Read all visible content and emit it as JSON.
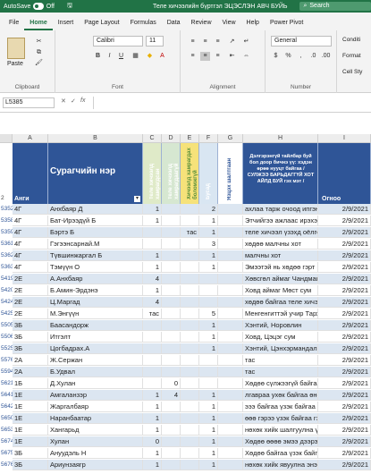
{
  "titlebar": {
    "autosave": "AutoSave",
    "autosave_state": "Off",
    "title": "Теле хичээлийн бүртгэл ЭЦЭСЛЭН АВЧ БУЙЬ",
    "search": "Search"
  },
  "tabs": [
    "File",
    "Home",
    "Insert",
    "Page Layout",
    "Formulas",
    "Data",
    "Review",
    "View",
    "Help",
    "Power Pivot"
  ],
  "ribbon": {
    "paste": "Paste",
    "clipboard": "Clipboard",
    "font_name": "Calibri",
    "font_size": "11",
    "font": "Font",
    "alignment": "Alignment",
    "number_format": "General",
    "number": "Number",
    "conditional": "Conditi",
    "format_as": "Format",
    "cell_styles": "Cell Sty",
    "bold": "B",
    "italic": "I",
    "underline": "U"
  },
  "formula_bar": {
    "name_box": "L5385",
    "fx": "fx",
    "value": ""
  },
  "columns": [
    "A",
    "B",
    "C",
    "D",
    "E",
    "F",
    "G",
    "H",
    "I"
  ],
  "headers": {
    "row_label": "2",
    "a": "Анги",
    "b": "Сурагчийн нэр",
    "h": "Дэлгэрэнгүй тайлбар буй бол доор бичнэ үү: хэдэн өрөө нууцт байгаа / СУЛЖЭЭ БАРЬДАГГҮЙ ХОТ АЙЛД БУЙ гэх мэт /",
    "i": "Огноо",
    "g": "Язцэх шалтгаан",
    "c": "Теле хичээлд хамрагдсан",
    "d": "Теле хичээлд хамрагдаагүй",
    "e": "Хичээлд хамрагдах боломжгүй",
    "f": "Бусад"
  },
  "rows": [
    {
      "num": "5352",
      "a": "4Г",
      "b": "Анхбаяр Д",
      "c": "1",
      "d": "",
      "e": "",
      "f": "2",
      "g": "",
      "h": "ахлаа тарж очоод ипгэн",
      "i": "2/9/2021"
    },
    {
      "num": "5358",
      "a": "4Г",
      "b": "Бат-Ирээдүй Б",
      "c": "1",
      "d": "",
      "e": "",
      "f": "1",
      "g": "",
      "h": "Этчийгээ ажлаас ирэхээр",
      "i": "2/9/2021"
    },
    {
      "num": "5359",
      "a": "4Г",
      "b": "Бэртэ Б",
      "c": "",
      "d": "",
      "e": "тас",
      "f": "1",
      "g": "",
      "h": "теле хичээл үзэхд оёлгох",
      "i": "2/9/2021"
    },
    {
      "num": "5361",
      "a": "4Г",
      "b": "Гэгээнсарнай.М",
      "c": "",
      "d": "",
      "e": "",
      "f": "3",
      "g": "",
      "h": "хөдөө малчны хот",
      "i": "2/9/2021"
    },
    {
      "num": "5362",
      "a": "4Г",
      "b": "Түвшинжаргал Б",
      "c": "1",
      "d": "",
      "e": "",
      "f": "1",
      "g": "",
      "h": "малчны хот",
      "i": "2/9/2021"
    },
    {
      "num": "5363",
      "a": "4Г",
      "b": "Тэмүүн О",
      "c": "1",
      "d": "",
      "e": "",
      "f": "1",
      "g": "",
      "h": "Эмээтэй нь хөдөө гэрт",
      "i": "2/9/2021"
    },
    {
      "num": "5419",
      "a": "2Е",
      "b": "А.Анхбаяр",
      "c": "4",
      "d": "",
      "e": "",
      "f": "",
      "g": "",
      "h": "Хөвсгөл аймаг Чандмань",
      "i": "2/9/2021"
    },
    {
      "num": "5420",
      "a": "2Е",
      "b": "Б.Амин-Эрдэнэ",
      "c": "1",
      "d": "",
      "e": "",
      "f": "",
      "g": "",
      "h": "Ховд аймаг Мөст сум",
      "i": "2/9/2021"
    },
    {
      "num": "5424",
      "a": "2Е",
      "b": "Ц.Маргад",
      "c": "4",
      "d": "",
      "e": "",
      "f": "",
      "g": "",
      "h": "хөдөө байгаа теле хичээл",
      "i": "2/9/2021"
    },
    {
      "num": "5425",
      "a": "2Е",
      "b": "М.Энгүүн",
      "c": "тас",
      "d": "",
      "e": "",
      "f": "5",
      "g": "",
      "h": "Менгенгиттэй учир Тархин",
      "i": "2/9/2021"
    },
    {
      "num": "5505",
      "a": "3Б",
      "b": "Баасандорж",
      "c": "",
      "d": "",
      "e": "",
      "f": "1",
      "g": "",
      "h": "Хэнтий, Норовлин",
      "i": "2/9/2021"
    },
    {
      "num": "5506",
      "a": "3Б",
      "b": "Итгэлт",
      "c": "",
      "d": "",
      "e": "",
      "f": "1",
      "g": "",
      "h": "Ховд, Цэцэг сум",
      "i": "2/9/2021"
    },
    {
      "num": "5525",
      "a": "3Б",
      "b": "Цогбадрах.А",
      "c": "",
      "d": "",
      "e": "",
      "f": "1",
      "g": "",
      "h": "Хэнтий, Цэнхэрмандал",
      "i": "2/9/2021"
    },
    {
      "num": "5576",
      "a": "2А",
      "b": "Ж.Сержан",
      "c": "",
      "d": "",
      "e": "",
      "f": "",
      "g": "",
      "h": "тас",
      "i": "2/9/2021"
    },
    {
      "num": "5594",
      "a": "2А",
      "b": "Б.Удвал",
      "c": "",
      "d": "",
      "e": "",
      "f": "",
      "g": "",
      "h": "тас",
      "i": "2/9/2021"
    },
    {
      "num": "5621",
      "a": "1Б",
      "b": "Д.Хулан",
      "c": "",
      "d": "0",
      "e": "",
      "f": "",
      "g": "",
      "h": "Хөдөө сүлжээгүй байгаа",
      "i": "2/9/2021"
    },
    {
      "num": "5641",
      "a": "1Е",
      "b": "Амгаланзэр",
      "c": "1",
      "d": "4",
      "e": "",
      "f": "1",
      "g": "",
      "h": "лгавраа ухөк байгаа өнөө маргаа",
      "i": "2/9/2021"
    },
    {
      "num": "5642",
      "a": "1Е",
      "b": "Жаргалбаяр",
      "c": "1",
      "d": "",
      "e": "",
      "f": "1",
      "g": "",
      "h": "эээ байгаа үзэк байгаа 5 дахь бүр",
      "i": "2/9/2021"
    },
    {
      "num": "5650",
      "a": "1Е",
      "b": "Наранбаатар",
      "c": "1",
      "d": "",
      "e": "",
      "f": "1",
      "g": "",
      "h": "өөө гэрээ үзэк байгаа гэмгэрээ",
      "i": "2/9/2021"
    },
    {
      "num": "5653",
      "a": "1Е",
      "b": "Хангарьд",
      "c": "1",
      "d": "",
      "e": "",
      "f": "1",
      "g": "",
      "h": "нөхөк хийк шалгуулна үзэхээ мэ",
      "i": "2/9/2021"
    },
    {
      "num": "5674",
      "a": "1Е",
      "b": "Хулан",
      "c": "0",
      "d": "",
      "e": "",
      "f": "1",
      "g": "",
      "h": "Хөдөө өөөө эмээ дээрээ байг",
      "i": "2/9/2021"
    },
    {
      "num": "5675",
      "a": "3Б",
      "b": "Ануудэль Н",
      "c": "1",
      "d": "",
      "e": "",
      "f": "1",
      "g": "",
      "h": "Хөдөө байгаа үзэк байгаа даалг",
      "i": "2/9/2021"
    },
    {
      "num": "5676",
      "a": "3Б",
      "b": "Ариунзаягр",
      "c": "1",
      "d": "",
      "e": "",
      "f": "1",
      "g": "",
      "h": "нөхөк хийк явуулна энэ д",
      "i": "2/9/2021"
    }
  ]
}
